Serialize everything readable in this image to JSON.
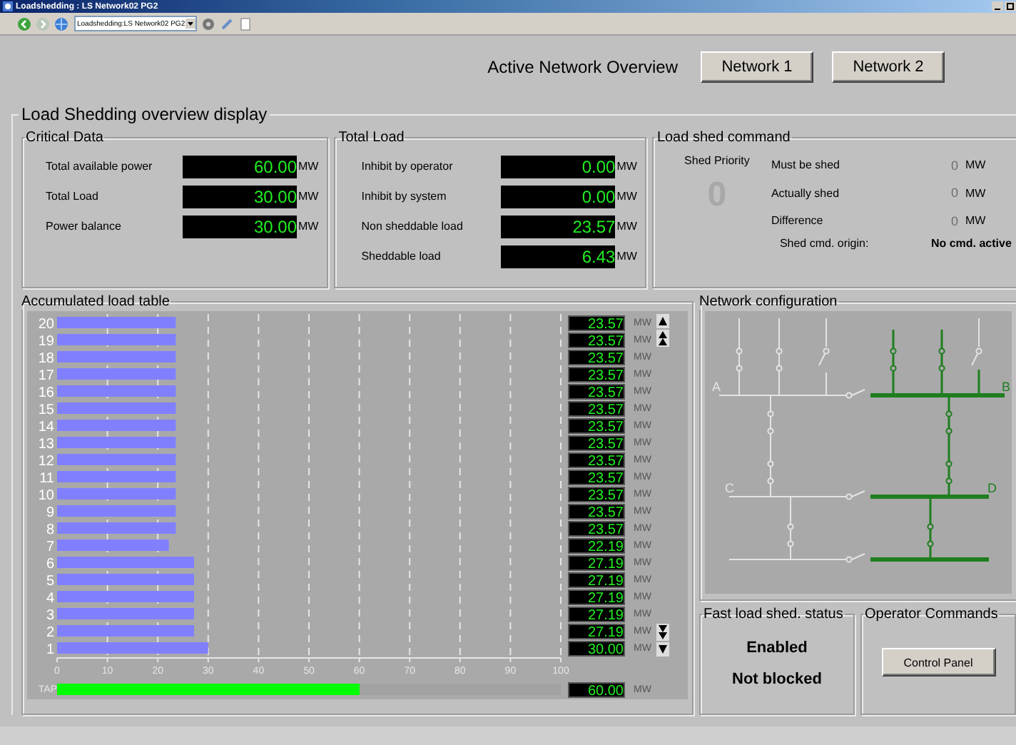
{
  "window": {
    "title": "Loadshedding : LS Network02 PG2"
  },
  "toolbar": {
    "address": "Loadshedding:LS Network02 PG2"
  },
  "header": {
    "title": "Active Network Overview",
    "buttons": [
      {
        "label": "Network 1"
      },
      {
        "label": "Network 2"
      }
    ]
  },
  "page_title": "Load Shedding overview display",
  "critical_data": {
    "title": "Critical Data",
    "rows": [
      {
        "label": "Total available power",
        "value": "60.00",
        "unit": "MW"
      },
      {
        "label": "Total Load",
        "value": "30.00",
        "unit": "MW"
      },
      {
        "label": "Power balance",
        "value": "30.00",
        "unit": "MW"
      }
    ]
  },
  "total_load": {
    "title": "Total Load",
    "rows": [
      {
        "label": "Inhibit by operator",
        "value": "0.00",
        "unit": "MW"
      },
      {
        "label": "Inhibit by system",
        "value": "0.00",
        "unit": "MW"
      },
      {
        "label": "Non sheddable load",
        "value": "23.57",
        "unit": "MW"
      },
      {
        "label": "Sheddable load",
        "value": "6.43",
        "unit": "MW"
      }
    ]
  },
  "load_shed_command": {
    "title": "Load shed command",
    "shed_priority_label": "Shed Priority",
    "shed_priority": "0",
    "rows": [
      {
        "label": "Must be shed",
        "value": "0",
        "unit": "MW"
      },
      {
        "label": "Actually shed",
        "value": "0",
        "unit": "MW"
      },
      {
        "label": "Difference",
        "value": "0",
        "unit": "MW"
      }
    ],
    "origin_label": "Shed cmd. origin:",
    "origin": "No cmd. active"
  },
  "accumulated_load_table": {
    "title": "Accumulated load table",
    "chart_data": {
      "type": "bar",
      "orientation": "horizontal",
      "categories": [
        "20",
        "19",
        "18",
        "17",
        "16",
        "15",
        "14",
        "13",
        "12",
        "11",
        "10",
        "9",
        "8",
        "7",
        "6",
        "5",
        "4",
        "3",
        "2",
        "1"
      ],
      "values": [
        23.57,
        23.57,
        23.57,
        23.57,
        23.57,
        23.57,
        23.57,
        23.57,
        23.57,
        23.57,
        23.57,
        23.57,
        23.57,
        22.19,
        27.19,
        27.19,
        27.19,
        27.19,
        27.19,
        30.0
      ],
      "xlim": [
        0,
        100
      ],
      "grid": true,
      "xticks": [
        0,
        10,
        20,
        30,
        40,
        50,
        60,
        70,
        80,
        90,
        100
      ]
    },
    "readings": [
      {
        "value": "23.57",
        "unit": "MW"
      },
      {
        "value": "23.57",
        "unit": "MW"
      },
      {
        "value": "23.57",
        "unit": "MW"
      },
      {
        "value": "23.57",
        "unit": "MW"
      },
      {
        "value": "23.57",
        "unit": "MW"
      },
      {
        "value": "23.57",
        "unit": "MW"
      },
      {
        "value": "23.57",
        "unit": "MW"
      },
      {
        "value": "23.57",
        "unit": "MW"
      },
      {
        "value": "23.57",
        "unit": "MW"
      },
      {
        "value": "23.57",
        "unit": "MW"
      },
      {
        "value": "23.57",
        "unit": "MW"
      },
      {
        "value": "23.57",
        "unit": "MW"
      },
      {
        "value": "23.57",
        "unit": "MW"
      },
      {
        "value": "22.19",
        "unit": "MW"
      },
      {
        "value": "27.19",
        "unit": "MW"
      },
      {
        "value": "27.19",
        "unit": "MW"
      },
      {
        "value": "27.19",
        "unit": "MW"
      },
      {
        "value": "27.19",
        "unit": "MW"
      },
      {
        "value": "27.19",
        "unit": "MW"
      },
      {
        "value": "30.00",
        "unit": "MW"
      }
    ],
    "tap": {
      "label": "TAP",
      "level": 0.6,
      "value": "60.00",
      "unit": "MW"
    }
  },
  "network_configuration": {
    "title": "Network configuration",
    "buses": [
      {
        "label": "A",
        "energized": false
      },
      {
        "label": "B",
        "energized": true
      },
      {
        "label": "C",
        "energized": false
      },
      {
        "label": "D",
        "energized": true
      }
    ]
  },
  "fast_load_shed_status": {
    "title": "Fast load shed. status",
    "lines": [
      "Enabled",
      "Not blocked"
    ]
  },
  "operator_commands": {
    "title": "Operator Commands",
    "button": "Control Panel"
  }
}
